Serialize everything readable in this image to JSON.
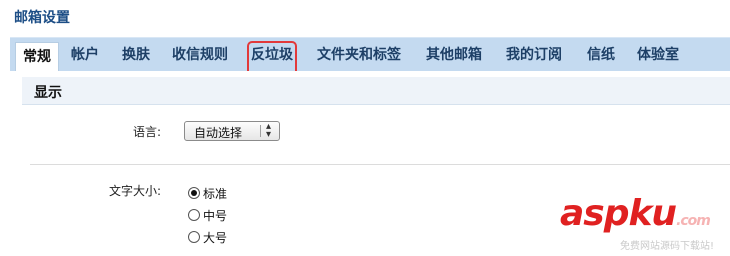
{
  "page": {
    "title": "邮箱设置"
  },
  "tabs": [
    {
      "label": "常规",
      "active": true
    },
    {
      "label": "帐户"
    },
    {
      "label": "换肤"
    },
    {
      "label": "收信规则"
    },
    {
      "label": "反垃圾",
      "highlighted": true
    },
    {
      "label": "文件夹和标签"
    },
    {
      "label": "其他邮箱"
    },
    {
      "label": "我的订阅"
    },
    {
      "label": "信纸"
    },
    {
      "label": "体验室"
    }
  ],
  "section": {
    "title": "显示"
  },
  "language": {
    "label": "语言:",
    "selected": "自动选择"
  },
  "font_size": {
    "label": "文字大小:",
    "options": [
      "标准",
      "中号",
      "大号"
    ],
    "selected_index": 0
  },
  "watermark": {
    "logo": "aspku",
    "logo_suffix": ".com",
    "subtext": "免费网站源码下载站!"
  },
  "colors": {
    "tabbar_bg": "#c4daf0",
    "title_color": "#1d4e86",
    "highlight_border": "#e2393a",
    "watermark_red": "#e02121"
  }
}
